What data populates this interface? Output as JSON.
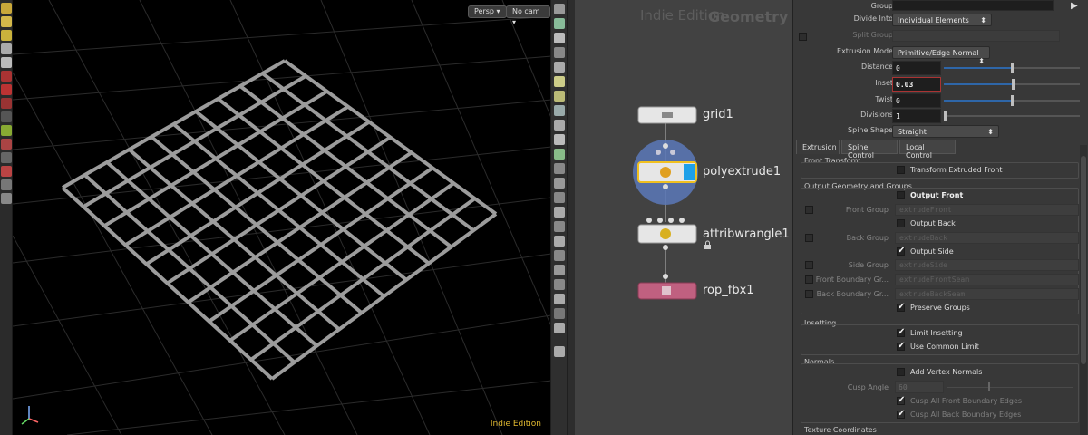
{
  "viewport": {
    "camera_mode_label": "Persp",
    "camera_label": "No cam",
    "edition_label": "Indie Edition"
  },
  "network": {
    "watermark_edition": "Indie Edition",
    "watermark_context": "Geometry",
    "nodes": [
      {
        "name": "grid1"
      },
      {
        "name": "polyextrude1"
      },
      {
        "name": "attribwrangle1"
      },
      {
        "name": "rop_fbx1"
      }
    ]
  },
  "params": {
    "group_label": "Group",
    "divide_into_label": "Divide Into",
    "divide_into_value": "Individual Elements",
    "split_group_label": "Split Group",
    "extrusion_mode_label": "Extrusion Mode",
    "extrusion_mode_value": "Primitive/Edge Normal",
    "distance_label": "Distance",
    "distance_value": "0",
    "inset_label": "Inset",
    "inset_value": "0.03",
    "twist_label": "Twist",
    "twist_value": "0",
    "divisions_label": "Divisions",
    "divisions_value": "1",
    "spine_shape_label": "Spine Shape",
    "spine_shape_value": "Straight",
    "tabs": [
      "Extrusion",
      "Spine Control",
      "Local Control"
    ],
    "front_transform": {
      "title": "Front Transform",
      "transform_extruded_front": "Transform Extruded Front"
    },
    "output": {
      "title": "Output Geometry and Groups",
      "output_front": "Output Front",
      "front_group_label": "Front Group",
      "front_group_value": "extrudeFront",
      "output_back": "Output Back",
      "back_group_label": "Back Group",
      "back_group_value": "extrudeBack",
      "output_side": "Output Side",
      "side_group_label": "Side Group",
      "side_group_value": "extrudeSide",
      "front_boundary_label": "Front Boundary Gr...",
      "front_boundary_value": "extrudeFrontSeam",
      "back_boundary_label": "Back Boundary Gr...",
      "back_boundary_value": "extrudeBackSeam",
      "preserve_groups": "Preserve Groups"
    },
    "insetting": {
      "title": "Insetting",
      "limit_insetting": "Limit Insetting",
      "use_common_limit": "Use Common Limit"
    },
    "normals": {
      "title": "Normals",
      "add_vertex_normals": "Add Vertex Normals",
      "cusp_angle_label": "Cusp Angle",
      "cusp_angle_value": "60",
      "cusp_front": "Cusp All Front Boundary Edges",
      "cusp_back": "Cusp All Back Boundary Edges"
    },
    "texture": {
      "title": "Texture Coordinates"
    }
  }
}
